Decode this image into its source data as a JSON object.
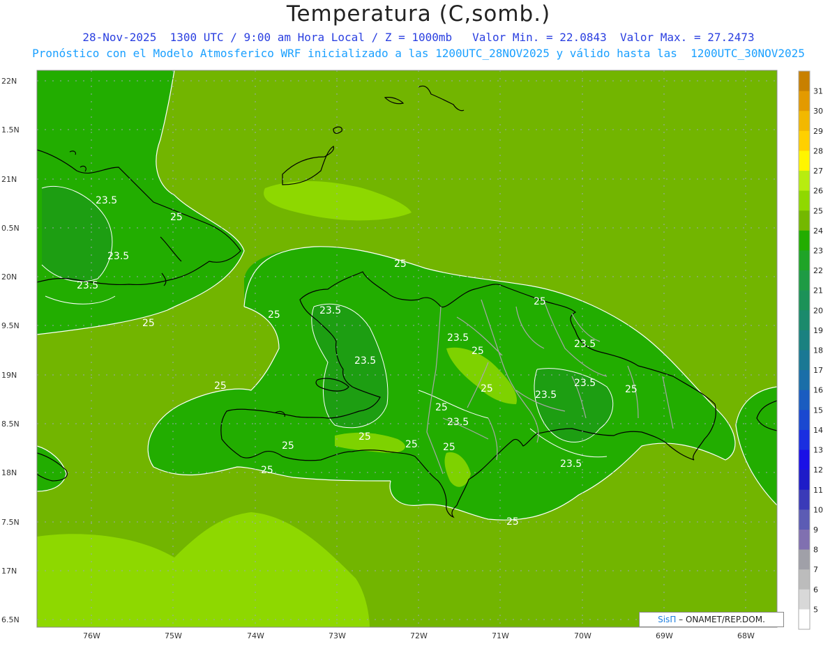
{
  "title": "Temperatura (C,somb.)",
  "subtitle_line1": "28-Nov-2025  1300 UTC / 9:00 am Hora Local / Z = 1000mb   Valor Min. = 22.0843  Valor Max. = 27.2473",
  "subtitle_line2": "Pronóstico con el Modelo Atmosferico WRF inicializado a las 1200UTC_28NOV2025 y válido hasta las  1200UTC_30NOV2025",
  "credit": {
    "brand": "SisΠ",
    "text": "– ONAMET/REP.DOM."
  },
  "lat_labels": [
    "22N",
    "1.5N",
    "21N",
    "0.5N",
    "20N",
    "9.5N",
    "19N",
    "8.5N",
    "18N",
    "7.5N",
    "17N",
    "6.5N"
  ],
  "lon_labels": [
    "76W",
    "75W",
    "74W",
    "73W",
    "72W",
    "71W",
    "70W",
    "69W",
    "68W"
  ],
  "contour_labels": [
    "23.5",
    "25",
    "23.5",
    "23.5",
    "25",
    "25",
    "23.5",
    "23.5",
    "25",
    "25",
    "23.5",
    "25",
    "23.5",
    "25",
    "23.5",
    "23.5",
    "25",
    "25",
    "25",
    "23.5",
    "25",
    "25",
    "25",
    "25"
  ],
  "colorbar": {
    "levels": [
      "31",
      "30",
      "29",
      "28",
      "27",
      "26",
      "25",
      "24",
      "23",
      "22",
      "21",
      "20",
      "19",
      "18",
      "17",
      "16",
      "15",
      "14",
      "13",
      "12",
      "11",
      "10",
      "9",
      "8",
      "7",
      "6",
      "5"
    ],
    "colors": [
      "#c88000",
      "#e39a00",
      "#f2b800",
      "#ffd000",
      "#fff500",
      "#b8ec10",
      "#90d800",
      "#74b800",
      "#22ad00",
      "#1fa427",
      "#1e9b44",
      "#1c9258",
      "#1b8a6c",
      "#1a8180",
      "#1a7894",
      "#1a6ea8",
      "#1a5cc0",
      "#1a48d0",
      "#1a2ee0",
      "#1a10e6",
      "#1e1cc8",
      "#3a3ab8",
      "#5c5cb4",
      "#8070b0",
      "#a0a0a8",
      "#bcbcbc",
      "#d8d8d8",
      "#ffffff"
    ]
  },
  "field_colors": {
    "base": "#72b500",
    "cool": "#22ad00",
    "warm": "#8ed800",
    "land_outline": "#000000",
    "province_outline": "#a8a8a8"
  }
}
